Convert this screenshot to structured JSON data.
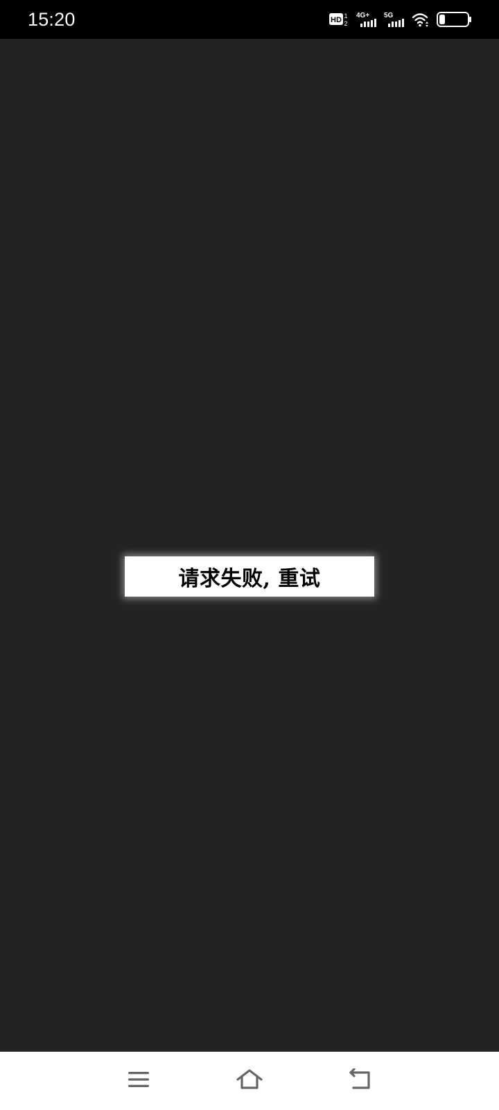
{
  "status_bar": {
    "time": "15:20",
    "icons": [
      "hd-voice-icon",
      "signal-4g-plus-icon",
      "signal-5g-icon",
      "wifi-icon",
      "battery-icon"
    ],
    "labels": {
      "hd": "HD",
      "sim1": "1",
      "sim2": "2",
      "net1": "4G+",
      "net2": "5G"
    },
    "battery_level": 0.2
  },
  "main": {
    "retry_label": "请求失败, 重试"
  },
  "nav_bar": {
    "icons": [
      "menu-icon",
      "home-icon",
      "back-icon"
    ]
  },
  "colors": {
    "background": "#232323",
    "status_bar": "#000000",
    "nav_bar": "#ffffff",
    "nav_icon": "#666666",
    "button_bg": "#ffffff",
    "button_text": "#000000"
  }
}
